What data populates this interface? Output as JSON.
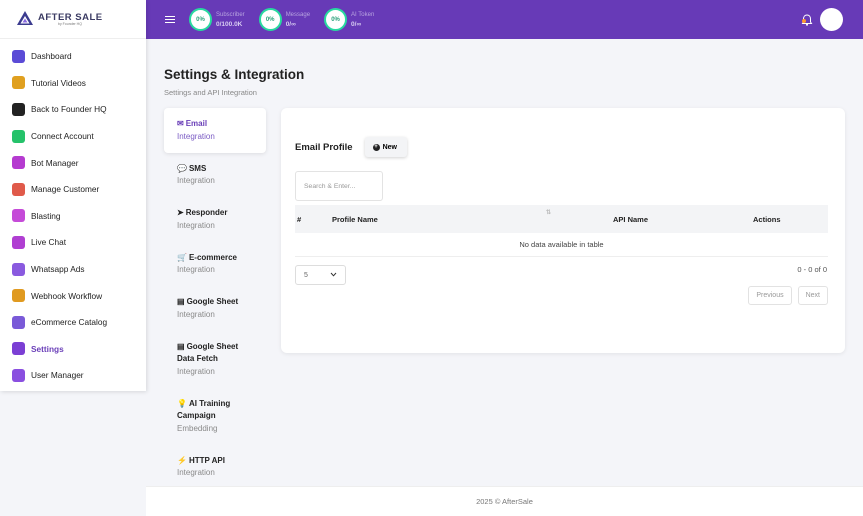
{
  "brand": {
    "name": "AFTER SALE",
    "tagline": "by Founder HQ"
  },
  "sidebar": {
    "items": [
      {
        "label": "Dashboard",
        "icon": "dashboard-grid-icon",
        "color": "#5b4bd6"
      },
      {
        "label": "Tutorial Videos",
        "icon": "video-icon",
        "color": "#e0a020"
      },
      {
        "label": "Back to Founder HQ",
        "icon": "founder-hq-icon",
        "color": "#222222"
      },
      {
        "label": "Connect Account",
        "icon": "whatsapp-icon",
        "color": "#25c26a"
      },
      {
        "label": "Bot Manager",
        "icon": "bot-icon",
        "color": "#b53bd0"
      },
      {
        "label": "Manage Customer",
        "icon": "customer-icon",
        "color": "#e05a4a"
      },
      {
        "label": "Blasting",
        "icon": "paper-plane-icon",
        "color": "#c54bd8"
      },
      {
        "label": "Live Chat",
        "icon": "chat-icon",
        "color": "#b03fd2"
      },
      {
        "label": "Whatsapp Ads",
        "icon": "ads-icon",
        "color": "#8a5adf"
      },
      {
        "label": "Webhook Workflow",
        "icon": "workflow-icon",
        "color": "#e09a20"
      },
      {
        "label": "eCommerce Catalog",
        "icon": "catalog-icon",
        "color": "#7a5ad8"
      },
      {
        "label": "Settings",
        "icon": "gear-icon",
        "color": "#7b3fd4"
      },
      {
        "label": "User Manager",
        "icon": "user-add-icon",
        "color": "#8a4fe0"
      }
    ],
    "active_index": 11
  },
  "topbar": {
    "stats": [
      {
        "percent": "0%",
        "label": "Subscriber",
        "value": "0/100.0K"
      },
      {
        "percent": "0%",
        "label": "Message",
        "value": "0/∞"
      },
      {
        "percent": "0%",
        "label": "AI Token",
        "value": "0/∞"
      }
    ]
  },
  "page": {
    "title": "Settings & Integration",
    "subtitle": "Settings and API Integration"
  },
  "subnav": {
    "items": [
      {
        "icon": "✉",
        "title": "Email",
        "desc": "Integration"
      },
      {
        "icon": "💬",
        "title": "SMS",
        "desc": "Integration"
      },
      {
        "icon": "➤",
        "title": "Responder",
        "desc": "Integration"
      },
      {
        "icon": "🛒",
        "title": "E-commerce",
        "desc": "Integration"
      },
      {
        "icon": "▤",
        "title": "Google Sheet",
        "desc": "Integration"
      },
      {
        "icon": "▤",
        "title": "Google Sheet Data Fetch",
        "desc": "Integration"
      },
      {
        "icon": "💡",
        "title": "AI Training Campaign",
        "desc": "Embedding"
      },
      {
        "icon": "⚡",
        "title": "HTTP API",
        "desc": "Integration"
      }
    ]
  },
  "email_profile": {
    "title": "Email Profile",
    "new_button": "New",
    "search_placeholder": "Search & Enter...",
    "columns": [
      "#",
      "Profile Name",
      "API Name",
      "Actions"
    ],
    "empty_text": "No data available in table",
    "page_size": "5",
    "info": "0 - 0 of 0",
    "previous": "Previous",
    "next": "Next"
  },
  "footer": {
    "text": "2025 © AfterSale"
  }
}
